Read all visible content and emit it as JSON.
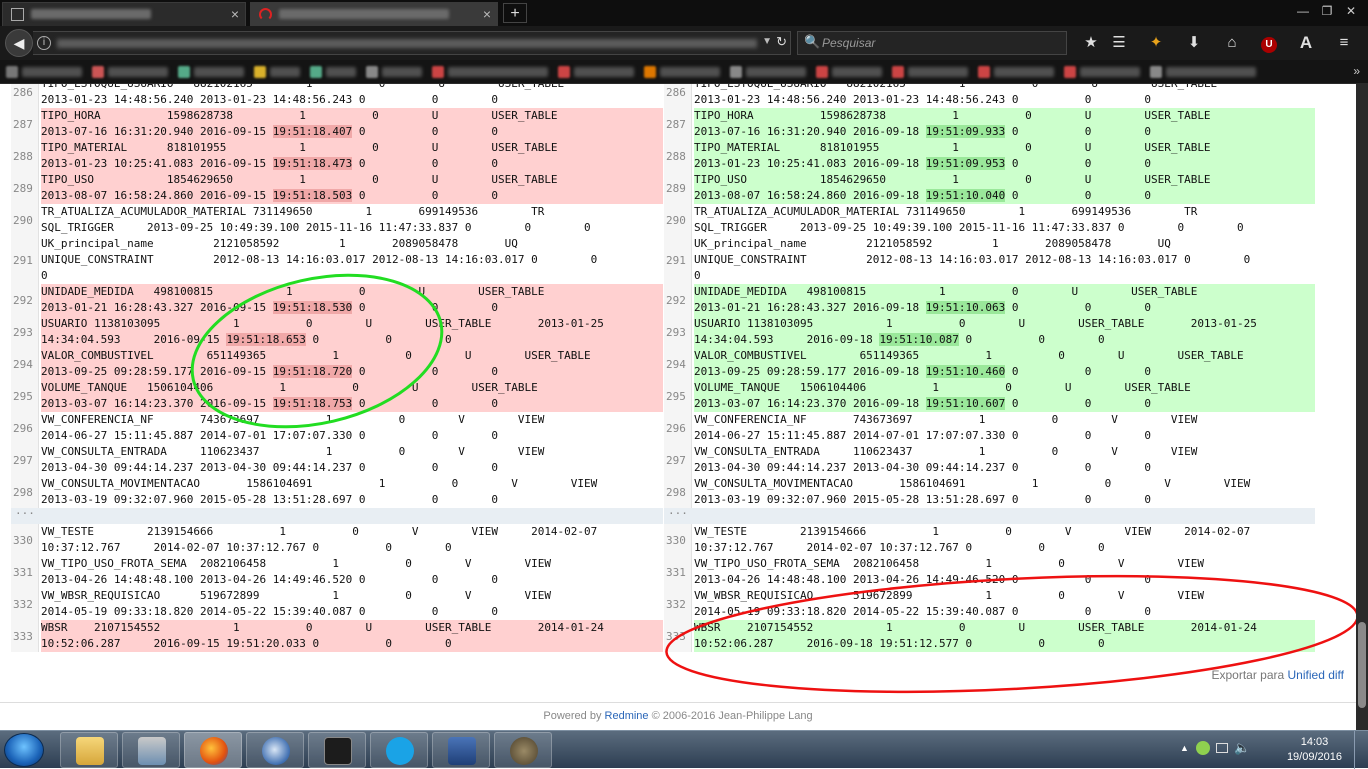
{
  "browser": {
    "tab1_close": "×",
    "tab2_close": "×",
    "newtab": "+",
    "search_placeholder": "Pesquisar"
  },
  "diff": {
    "left": [
      {
        "ln": "286",
        "type": "ctx",
        "lines": [
          "TIPO_ESTOQUE_USUARIO   882102165        1          0        U        USER_TABLE",
          "2013-01-23 14:48:56.240 2013-01-23 14:48:56.243 0          0        0"
        ]
      },
      {
        "ln": "287",
        "type": "del",
        "lines": [
          "TIPO_HORA          1598628738          1          0        U        USER_TABLE",
          "2013-07-16 16:31:20.940 2016-09-15 |19:51:18.407| 0          0        0"
        ]
      },
      {
        "ln": "288",
        "type": "del",
        "lines": [
          "TIPO_MATERIAL      818101955           1          0        U        USER_TABLE",
          "2013-01-23 10:25:41.083 2016-09-15 |19:51:18.473| 0          0        0"
        ]
      },
      {
        "ln": "289",
        "type": "del",
        "lines": [
          "TIPO_USO           1854629650          1          0        U        USER_TABLE",
          "2013-08-07 16:58:24.860 2016-09-15 |19:51:18.503| 0          0        0"
        ]
      },
      {
        "ln": "290",
        "type": "ctx",
        "lines": [
          "TR_ATUALIZA_ACUMULADOR_MATERIAL 731149650        1       699149536        TR",
          "SQL_TRIGGER     2013-09-25 10:49:39.100 2015-11-16 11:47:33.837 0        0        0"
        ]
      },
      {
        "ln": "291",
        "type": "ctx",
        "lines": [
          "UK_principal_name         2121058592         1       2089058478       UQ",
          "UNIQUE_CONSTRAINT         2012-08-13 14:16:03.017 2012-08-13 14:16:03.017 0        0",
          "0"
        ]
      },
      {
        "ln": "292",
        "type": "del",
        "lines": [
          "UNIDADE_MEDIDA   498100815           1          0        U        USER_TABLE",
          "2013-01-21 16:28:43.327 2016-09-15 |19:51:18.530| 0          0        0"
        ]
      },
      {
        "ln": "293",
        "type": "del",
        "lines": [
          "USUARIO 1138103095           1          0        U        USER_TABLE       2013-01-25",
          "14:34:04.593     2016-09-15 |19:51:18.653| 0          0        0"
        ]
      },
      {
        "ln": "294",
        "type": "del",
        "lines": [
          "VALOR_COMBUSTIVEL        651149365          1          0        U        USER_TABLE",
          "2013-09-25 09:28:59.177 2016-09-15 |19:51:18.720| 0          0        0"
        ]
      },
      {
        "ln": "295",
        "type": "del",
        "lines": [
          "VOLUME_TANQUE   1506104406          1          0        U        USER_TABLE",
          "2013-03-07 16:14:23.370 2016-09-15 |19:51:18.753| 0          0        0"
        ]
      },
      {
        "ln": "296",
        "type": "ctx",
        "lines": [
          "VW_CONFERENCIA_NF       743673697          1          0        V        VIEW",
          "2014-06-27 15:11:45.887 2014-07-01 17:07:07.330 0          0        0"
        ]
      },
      {
        "ln": "297",
        "type": "ctx",
        "lines": [
          "VW_CONSULTA_ENTRADA     110623437          1          0        V        VIEW",
          "2013-04-30 09:44:14.237 2013-04-30 09:44:14.237 0          0        0"
        ]
      },
      {
        "ln": "298",
        "type": "ctx",
        "lines": [
          "VW_CONSULTA_MOVIMENTACAO       1586104691          1          0        V        VIEW",
          "2013-03-19 09:32:07.960 2015-05-28 13:51:28.697 0          0        0"
        ]
      },
      {
        "ln": "330",
        "type": "ctx",
        "lines": [
          "VW_TESTE        2139154666          1          0        V        VIEW     2014-02-07",
          "10:37:12.767     2014-02-07 10:37:12.767 0          0        0"
        ]
      },
      {
        "ln": "331",
        "type": "ctx",
        "lines": [
          "VW_TIPO_USO_FROTA_SEMA  2082106458          1          0        V        VIEW",
          "2013-04-26 14:48:48.100 2013-04-26 14:49:46.520 0          0        0"
        ]
      },
      {
        "ln": "332",
        "type": "ctx",
        "lines": [
          "VW_WBSR_REQUISICAO      519672899           1          0        V        VIEW",
          "2014-05-19 09:33:18.820 2014-05-22 15:39:40.087 0          0        0"
        ]
      },
      {
        "ln": "333",
        "type": "del",
        "lines": [
          "WBSR    2107154552           1          0        U        USER_TABLE       2014-01-24",
          "10:52:06.287     2016-09-15 19:51:20.033 0          0        0"
        ]
      }
    ],
    "right": [
      {
        "ln": "286",
        "type": "ctx",
        "lines": [
          "TIPO_ESTOQUE_USUARIO   882102165        1          0        U        USER_TABLE",
          "2013-01-23 14:48:56.240 2013-01-23 14:48:56.243 0          0        0"
        ]
      },
      {
        "ln": "287",
        "type": "ins",
        "lines": [
          "TIPO_HORA          1598628738          1          0        U        USER_TABLE",
          "2013-07-16 16:31:20.940 2016-09-18 |19:51:09.933| 0          0        0"
        ]
      },
      {
        "ln": "288",
        "type": "ins",
        "lines": [
          "TIPO_MATERIAL      818101955           1          0        U        USER_TABLE",
          "2013-01-23 10:25:41.083 2016-09-18 |19:51:09.953| 0          0        0"
        ]
      },
      {
        "ln": "289",
        "type": "ins",
        "lines": [
          "TIPO_USO           1854629650          1          0        U        USER_TABLE",
          "2013-08-07 16:58:24.860 2016-09-18 |19:51:10.040| 0          0        0"
        ]
      },
      {
        "ln": "290",
        "type": "ctx",
        "lines": [
          "TR_ATUALIZA_ACUMULADOR_MATERIAL 731149650        1       699149536        TR",
          "SQL_TRIGGER     2013-09-25 10:49:39.100 2015-11-16 11:47:33.837 0        0        0"
        ]
      },
      {
        "ln": "291",
        "type": "ctx",
        "lines": [
          "UK_principal_name         2121058592         1       2089058478       UQ",
          "UNIQUE_CONSTRAINT         2012-08-13 14:16:03.017 2012-08-13 14:16:03.017 0        0",
          "0"
        ]
      },
      {
        "ln": "292",
        "type": "ins",
        "lines": [
          "UNIDADE_MEDIDA   498100815           1          0        U        USER_TABLE",
          "2013-01-21 16:28:43.327 2016-09-18 |19:51:10.063| 0          0        0"
        ]
      },
      {
        "ln": "293",
        "type": "ins",
        "lines": [
          "USUARIO 1138103095           1          0        U        USER_TABLE       2013-01-25",
          "14:34:04.593     2016-09-18 |19:51:10.087| 0          0        0"
        ]
      },
      {
        "ln": "294",
        "type": "ins",
        "lines": [
          "VALOR_COMBUSTIVEL        651149365          1          0        U        USER_TABLE",
          "2013-09-25 09:28:59.177 2016-09-18 |19:51:10.460| 0          0        0"
        ]
      },
      {
        "ln": "295",
        "type": "ins",
        "lines": [
          "VOLUME_TANQUE   1506104406          1          0        U        USER_TABLE",
          "2013-03-07 16:14:23.370 2016-09-18 |19:51:10.607| 0          0        0"
        ]
      },
      {
        "ln": "296",
        "type": "ctx",
        "lines": [
          "VW_CONFERENCIA_NF       743673697          1          0        V        VIEW",
          "2014-06-27 15:11:45.887 2014-07-01 17:07:07.330 0          0        0"
        ]
      },
      {
        "ln": "297",
        "type": "ctx",
        "lines": [
          "VW_CONSULTA_ENTRADA     110623437          1          0        V        VIEW",
          "2013-04-30 09:44:14.237 2013-04-30 09:44:14.237 0          0        0"
        ]
      },
      {
        "ln": "298",
        "type": "ctx",
        "lines": [
          "VW_CONSULTA_MOVIMENTACAO       1586104691          1          0        V        VIEW",
          "2013-03-19 09:32:07.960 2015-05-28 13:51:28.697 0          0        0"
        ]
      },
      {
        "ln": "330",
        "type": "ctx",
        "lines": [
          "VW_TESTE        2139154666          1          0        V        VIEW     2014-02-07",
          "10:37:12.767     2014-02-07 10:37:12.767 0          0        0"
        ]
      },
      {
        "ln": "331",
        "type": "ctx",
        "lines": [
          "VW_TIPO_USO_FROTA_SEMA  2082106458          1          0        V        VIEW",
          "2013-04-26 14:48:48.100 2013-04-26 14:49:46.520 0          0        0"
        ]
      },
      {
        "ln": "332",
        "type": "ctx",
        "lines": [
          "VW_WBSR_REQUISICAO      519672899           1          0        V        VIEW",
          "2014-05-19 09:33:18.820 2014-05-22 15:39:40.087 0          0        0"
        ]
      },
      {
        "ln": "333",
        "type": "ins",
        "lines": [
          "WBSR    2107154552           1          0        U        USER_TABLE       2014-01-24",
          "10:52:06.287     2016-09-18 19:51:12.577 0          0        0"
        ]
      }
    ],
    "gap_marker": "..."
  },
  "export": {
    "prefix": "Exportar para",
    "link": "Unified diff"
  },
  "footer": {
    "prefix": "Powered by",
    "link": "Redmine",
    "suffix": "© 2006-2016 Jean-Philippe Lang"
  },
  "taskbar": {
    "time": "14:03",
    "date": "19/09/2016"
  },
  "colors": {
    "del_bg": "#ffd0d0",
    "del_mark": "#f0a8a8",
    "ins_bg": "#ccffcc",
    "ins_mark": "#9ae89a",
    "annotation_green": "#22dd22",
    "annotation_red": "#ee1111"
  }
}
